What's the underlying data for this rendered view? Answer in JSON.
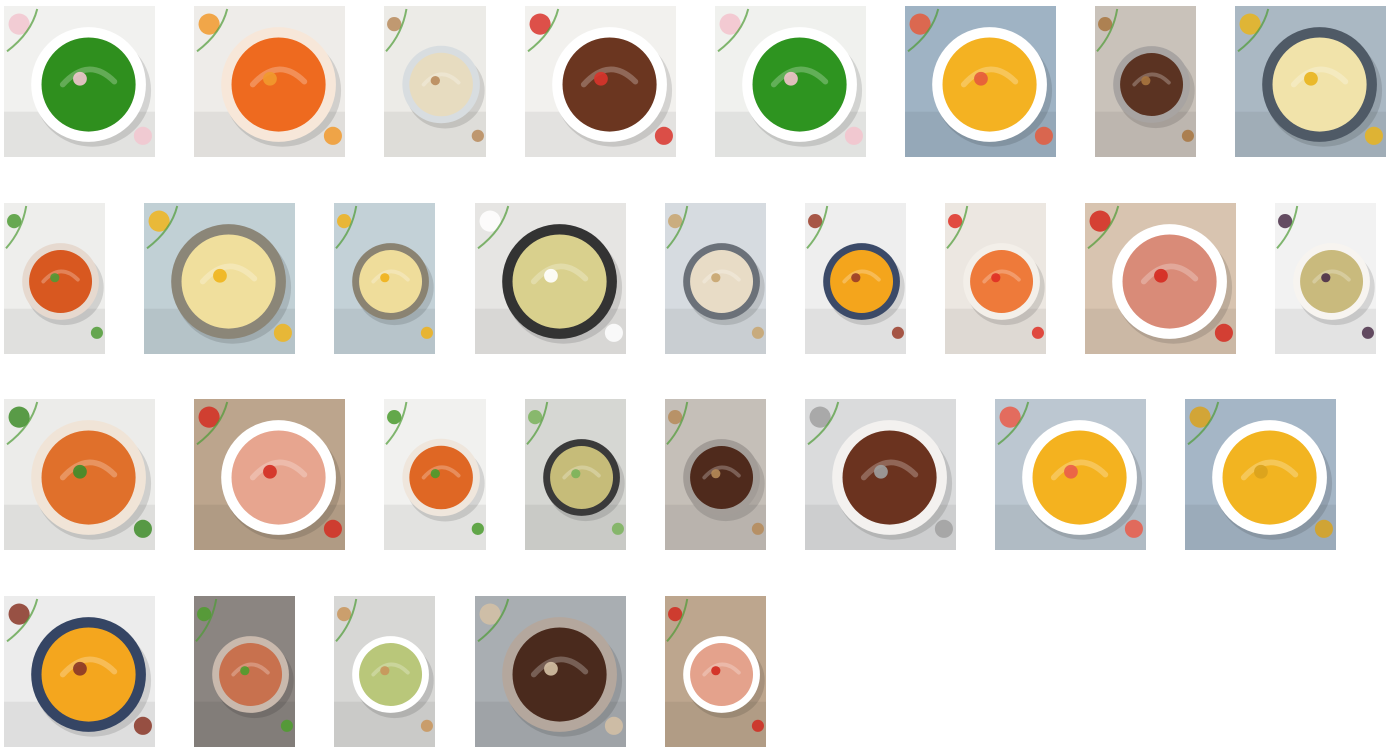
{
  "gallery": {
    "rows": [
      {
        "tiles": [
          {
            "name": "gallery-thumbnail-pea-herb-puree",
            "bg": "#f1f1ef",
            "bowl": "#ffffff",
            "food": "#2f8f1e",
            "accent": "#f2c6cf"
          },
          {
            "name": "gallery-thumbnail-papaya-smoothie",
            "bg": "#eeece9",
            "bowl": "#f7e7d9",
            "food": "#ee6a1f",
            "accent": "#f19a2d"
          },
          {
            "name": "gallery-thumbnail-white-bean-dip",
            "bg": "#ecebe7",
            "bowl": "#d8dde0",
            "food": "#e7dcc0",
            "accent": "#b98b5c"
          },
          {
            "name": "gallery-thumbnail-spiced-chocolate-sauce",
            "bg": "#f2f1ee",
            "bowl": "#ffffff",
            "food": "#6b3620",
            "accent": "#d9342b"
          },
          {
            "name": "gallery-thumbnail-pea-herb-puree-wide",
            "bg": "#f0f1ee",
            "bowl": "#ffffff",
            "food": "#2e9420",
            "accent": "#f3c3cc"
          },
          {
            "name": "gallery-thumbnail-peach-puree",
            "bg": "#9fb3c4",
            "bowl": "#ffffff",
            "food": "#f4b222",
            "accent": "#e55a3c"
          },
          {
            "name": "gallery-thumbnail-chocolate-spread-jar",
            "bg": "#c9c2ba",
            "bowl": "#a8a4a2",
            "food": "#5b3322",
            "accent": "#a8753f"
          },
          {
            "name": "gallery-thumbnail-corn-cream-soup",
            "bg": "#aab8c3",
            "bowl": "#4f5a66",
            "food": "#f1e3aa",
            "accent": "#e9b41d"
          }
        ]
      },
      {
        "tiles": [
          {
            "name": "gallery-thumbnail-carrot-puree-jar",
            "bg": "#eeeeec",
            "bowl": "#e6d9cf",
            "food": "#d85820",
            "accent": "#4f9b36"
          },
          {
            "name": "gallery-thumbnail-corn-velvet-soup",
            "bg": "#c1d0d5",
            "bowl": "#8b8678",
            "food": "#f0df9d",
            "accent": "#f0b51d"
          },
          {
            "name": "gallery-thumbnail-corn-soup-small",
            "bg": "#c3d1d7",
            "bowl": "#8a8372",
            "food": "#efdd9b",
            "accent": "#f0b11a"
          },
          {
            "name": "gallery-thumbnail-cream-soup-dark-bowl",
            "bg": "#e6e5e3",
            "bowl": "#333333",
            "food": "#d9d08d",
            "accent": "#ffffff"
          },
          {
            "name": "gallery-thumbnail-creamy-pasta",
            "bg": "#d6dbe0",
            "bowl": "#6b7179",
            "food": "#e8dcc6",
            "accent": "#c8a56f"
          },
          {
            "name": "gallery-thumbnail-pumpkin-soup-lemongrass",
            "bg": "#eeeeee",
            "bowl": "#3b4a68",
            "food": "#f4a51c",
            "accent": "#9a3c29"
          },
          {
            "name": "gallery-thumbnail-gazpacho",
            "bg": "#ece7e1",
            "bowl": "#f3efe9",
            "food": "#ee7a3a",
            "accent": "#df2f25"
          },
          {
            "name": "gallery-thumbnail-tabbouleh-tuna-spread",
            "bg": "#d8c4b0",
            "bowl": "#ffffff",
            "food": "#d98b78",
            "accent": "#d5291f"
          },
          {
            "name": "gallery-thumbnail-eggplant-caviar",
            "bg": "#f2f2f2",
            "bowl": "#f7f4f0",
            "food": "#c9ba7d",
            "accent": "#4b2f49"
          }
        ]
      },
      {
        "tiles": [
          {
            "name": "gallery-thumbnail-carrot-spread-jar-close",
            "bg": "#ececea",
            "bowl": "#f0e4d7",
            "food": "#e0702b",
            "accent": "#3f8d2a"
          },
          {
            "name": "gallery-thumbnail-pepper-spread",
            "bg": "#bca58d",
            "bowl": "#ffffff",
            "food": "#e7a58f",
            "accent": "#d32d21"
          },
          {
            "name": "gallery-thumbnail-carrot-jar-parsley",
            "bg": "#f1f1ef",
            "bowl": "#efe6dc",
            "food": "#df6724",
            "accent": "#4a9b2d"
          },
          {
            "name": "gallery-thumbnail-lentil-cream",
            "bg": "#d6d7d3",
            "bowl": "#3a3a3a",
            "food": "#c6bc79",
            "accent": "#7ab35a"
          },
          {
            "name": "gallery-thumbnail-chocolate-mousse-jar",
            "bg": "#c5bfb8",
            "bowl": "#a39d98",
            "food": "#4f2a1c",
            "accent": "#b58a58"
          },
          {
            "name": "gallery-thumbnail-chocolate-sauce-spoon",
            "bg": "#dadbdc",
            "bowl": "#f3f1ef",
            "food": "#6b331f",
            "accent": "#a0a0a0"
          },
          {
            "name": "gallery-thumbnail-peach-compote",
            "bg": "#bcc7d1",
            "bowl": "#ffffff",
            "food": "#f4b21f",
            "accent": "#ea5c4a"
          },
          {
            "name": "gallery-thumbnail-apple-compote",
            "bg": "#a5b6c6",
            "bowl": "#ffffff",
            "food": "#f2b421",
            "accent": "#d9a21d"
          }
        ]
      },
      {
        "tiles": [
          {
            "name": "gallery-thumbnail-pumpkin-soup-bowl",
            "bg": "#ececec",
            "bowl": "#354564",
            "food": "#f4a61e",
            "accent": "#8a3627"
          },
          {
            "name": "gallery-thumbnail-tomato-verrine",
            "bg": "#8b8581",
            "bowl": "#c9b9ad",
            "food": "#c8714e",
            "accent": "#4e9d2d"
          },
          {
            "name": "gallery-thumbnail-avocado-toasts",
            "bg": "#d7d7d5",
            "bowl": "#ffffff",
            "food": "#b9c77a",
            "accent": "#c9955b"
          },
          {
            "name": "gallery-thumbnail-chocolate-mousse-glass",
            "bg": "#a9aeb2",
            "bowl": "#b4a79d",
            "food": "#4a2a1d",
            "accent": "#d5c1a5"
          },
          {
            "name": "gallery-thumbnail-pepper-spread-tall",
            "bg": "#bda68e",
            "bowl": "#ffffff",
            "food": "#e4a28c",
            "accent": "#d1291e"
          }
        ]
      }
    ]
  }
}
